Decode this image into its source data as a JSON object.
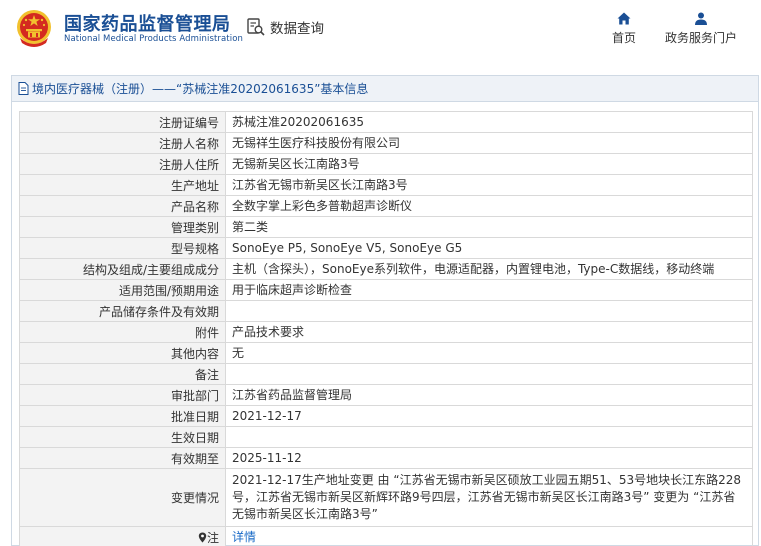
{
  "header": {
    "title_cn": "国家药品监督管理局",
    "title_en": "National Medical Products Administration",
    "search_label": "数据查询",
    "nav": {
      "home": "首页",
      "portal": "政务服务门户"
    }
  },
  "panel": {
    "title": "境内医疗器械（注册）——“苏械注准20202061635”基本信息"
  },
  "rows": [
    {
      "label": "注册证编号",
      "value": "苏械注准20202061635"
    },
    {
      "label": "注册人名称",
      "value": "无锡祥生医疗科技股份有限公司"
    },
    {
      "label": "注册人住所",
      "value": "无锡新吴区长江南路3号"
    },
    {
      "label": "生产地址",
      "value": "江苏省无锡市新吴区长江南路3号"
    },
    {
      "label": "产品名称",
      "value": "全数字掌上彩色多普勒超声诊断仪"
    },
    {
      "label": "管理类别",
      "value": "第二类"
    },
    {
      "label": "型号规格",
      "value": "SonoEye P5, SonoEye V5, SonoEye G5"
    },
    {
      "label": "结构及组成/主要组成成分",
      "value": "主机（含探头），SonoEye系列软件，电源适配器，内置锂电池，Type-C数据线，移动终端"
    },
    {
      "label": "适用范围/预期用途",
      "value": "用于临床超声诊断检查"
    },
    {
      "label": "产品储存条件及有效期",
      "value": ""
    },
    {
      "label": "附件",
      "value": "产品技术要求"
    },
    {
      "label": "其他内容",
      "value": "无"
    },
    {
      "label": "备注",
      "value": ""
    },
    {
      "label": "审批部门",
      "value": "江苏省药品监督管理局"
    },
    {
      "label": "批准日期",
      "value": "2021-12-17"
    },
    {
      "label": "生效日期",
      "value": ""
    },
    {
      "label": "有效期至",
      "value": "2025-11-12"
    },
    {
      "label": "变更情况",
      "value": "2021-12-17生产地址变更 由 “江苏省无锡市新吴区硕放工业园五期51、53号地块长江东路228号，江苏省无锡市新吴区新辉环路9号四层，江苏省无锡市新吴区长江南路3号” 变更为 “江苏省无锡市新吴区长江南路3号”"
    },
    {
      "label": "注",
      "value": "详情"
    }
  ],
  "colors": {
    "brand_blue": "#1a4f95",
    "link_blue": "#1a6bc7",
    "emblem_red": "#d42a20",
    "emblem_gold": "#f2c12e"
  },
  "icons": {
    "emblem": "national-emblem-icon",
    "search": "magnifier-document-icon",
    "home": "home-icon",
    "portal": "person-icon",
    "doc": "document-icon",
    "note": "location-pin-icon"
  }
}
